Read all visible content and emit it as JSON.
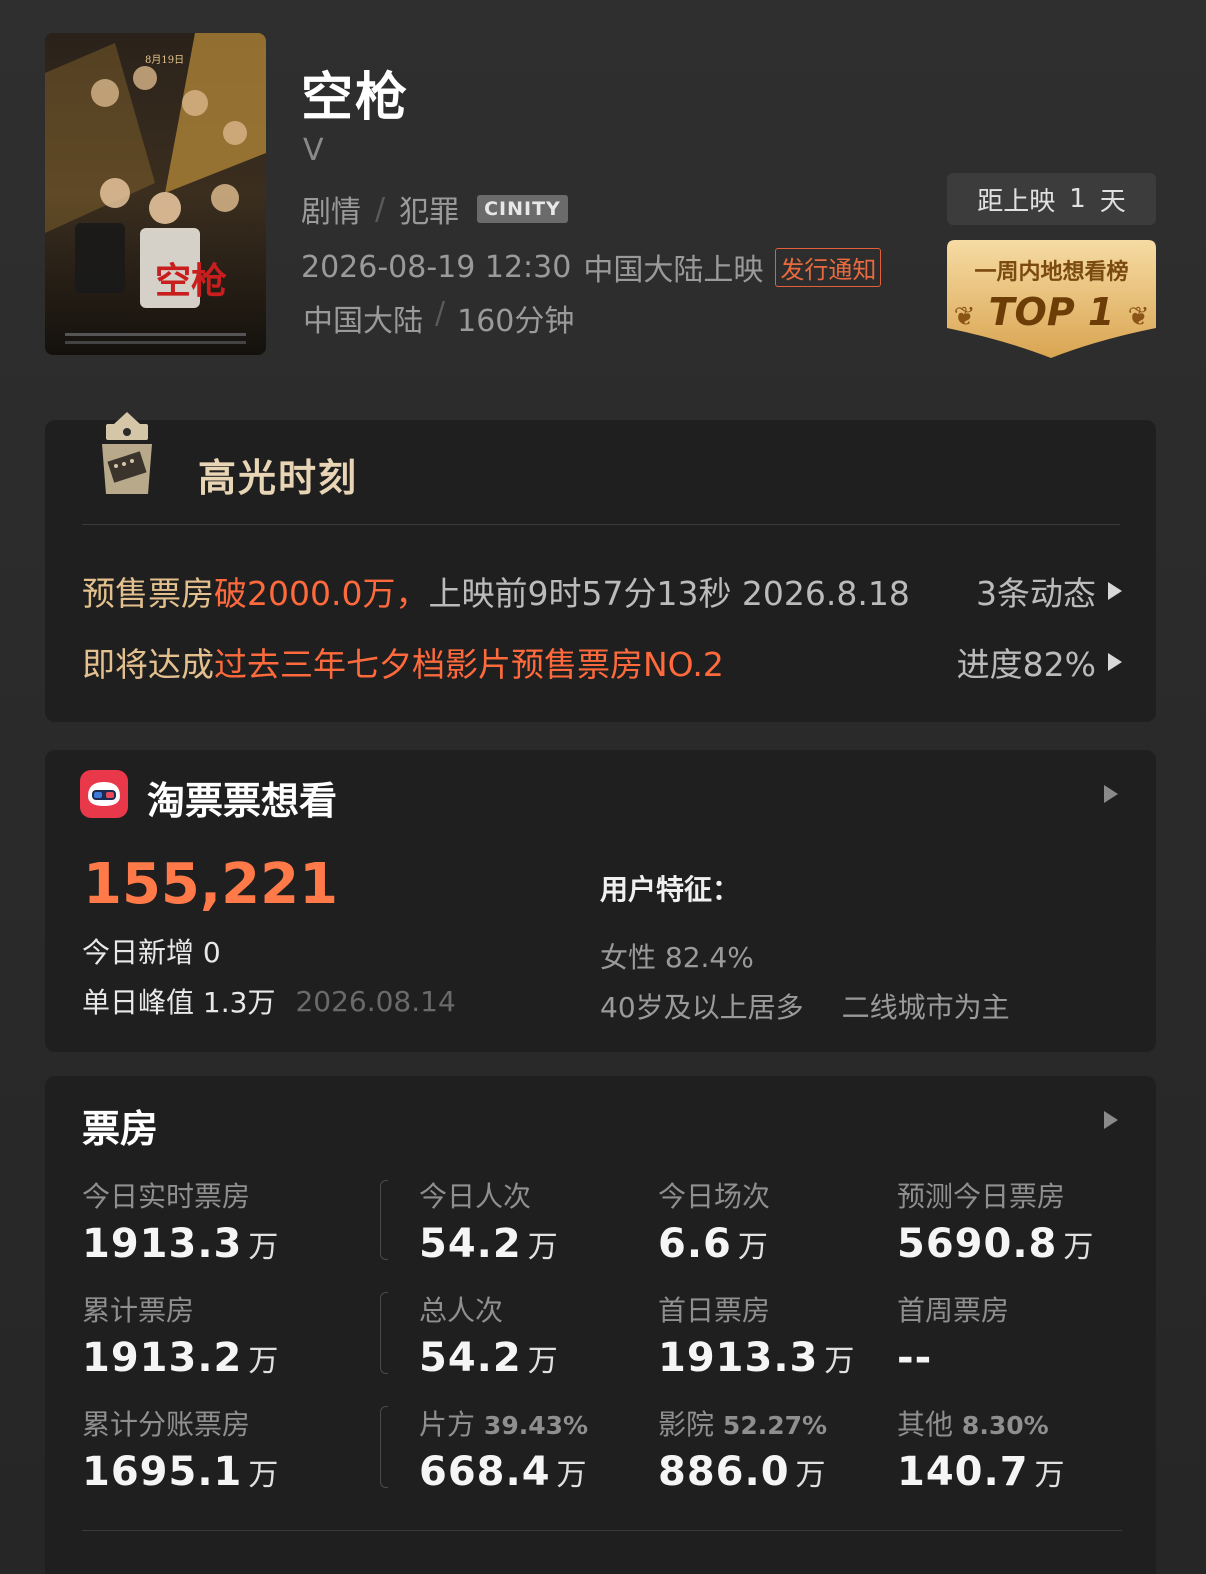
{
  "movie": {
    "title": "空枪",
    "subtitle": "V",
    "genres": [
      "剧情",
      "犯罪"
    ],
    "genre_sep": "/",
    "format_badge": "CINITY",
    "release_datetime": "2026-08-19 12:30",
    "release_text": "中国大陆上映",
    "notice_label": "发行通知",
    "region": "中国大陆",
    "duration": "160分钟",
    "poster_icon": "movie-poster"
  },
  "countdown": {
    "prefix": "距上映",
    "days": "1",
    "suffix": "天"
  },
  "rank": {
    "label": "一周内地想看榜",
    "top": "TOP 1"
  },
  "highlight": {
    "title": "高光时刻",
    "row1": {
      "prefix": "预售票房 ",
      "emph": "破2000.0万，",
      "detail": " 上映前9时57分13秒 2026.8.18",
      "right": "3条动态"
    },
    "row2": {
      "prefix": "即将达成 ",
      "emph": "过去三年七夕档影片预售票房NO.2",
      "right": "进度82%"
    }
  },
  "want": {
    "title": "淘票票想看",
    "count": "155,221",
    "today_new_label": "今日新增",
    "today_new": "0",
    "peak_label": "单日峰值",
    "peak": "1.3万",
    "peak_date": "2026.08.14",
    "features_title": "用户特征：",
    "features_line1": "女性 82.4%",
    "features_age": "40岁及以上居多",
    "features_city": "二线城市为主"
  },
  "boxoffice": {
    "title": "票房",
    "unit": "万",
    "rows": [
      [
        {
          "label": "今日实时票房",
          "pct": "",
          "value": "1913.3"
        },
        {
          "label": "今日人次",
          "pct": "",
          "value": "54.2"
        },
        {
          "label": "今日场次",
          "pct": "",
          "value": "6.6"
        },
        {
          "label": "预测今日票房",
          "pct": "",
          "value": "5690.8"
        }
      ],
      [
        {
          "label": "累计票房",
          "pct": "",
          "value": "1913.2"
        },
        {
          "label": "总人次",
          "pct": "",
          "value": "54.2"
        },
        {
          "label": "首日票房",
          "pct": "",
          "value": "1913.3"
        },
        {
          "label": "首周票房",
          "pct": "",
          "value": "--"
        }
      ],
      [
        {
          "label": "累计分账票房",
          "pct": "",
          "value": "1695.1"
        },
        {
          "label": "片方",
          "pct": "39.43%",
          "value": "668.4"
        },
        {
          "label": "影院",
          "pct": "52.27%",
          "value": "886.0"
        },
        {
          "label": "其他",
          "pct": "8.30%",
          "value": "140.7"
        }
      ]
    ]
  }
}
